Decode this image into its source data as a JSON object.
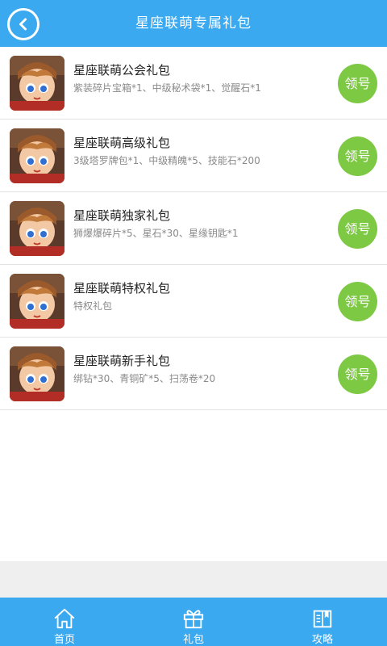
{
  "header": {
    "title": "星座联萌专属礼包",
    "back_icon": "back-arrow-icon"
  },
  "colors": {
    "primary": "#3aa9f0",
    "claim": "#7dc944"
  },
  "gifts": [
    {
      "name": "星座联萌公会礼包",
      "desc": "紫装碎片宝箱*1、中级秘术袋*1、觉醒石*1",
      "button": "领号"
    },
    {
      "name": "星座联萌高级礼包",
      "desc": "3级塔罗牌包*1、中级精魄*5、技能石*200",
      "button": "领号"
    },
    {
      "name": "星座联萌独家礼包",
      "desc": "狮爆爆碎片*5、星石*30、星缘钥匙*1",
      "button": "领号"
    },
    {
      "name": "星座联萌特权礼包",
      "desc": "特权礼包",
      "button": "领号"
    },
    {
      "name": "星座联萌新手礼包",
      "desc": "绑钻*30、青铜矿*5、扫荡卷*20",
      "button": "领号"
    }
  ],
  "tabs": [
    {
      "label": "首页",
      "icon": "home-icon"
    },
    {
      "label": "礼包",
      "icon": "gift-icon"
    },
    {
      "label": "攻略",
      "icon": "book-icon"
    }
  ]
}
